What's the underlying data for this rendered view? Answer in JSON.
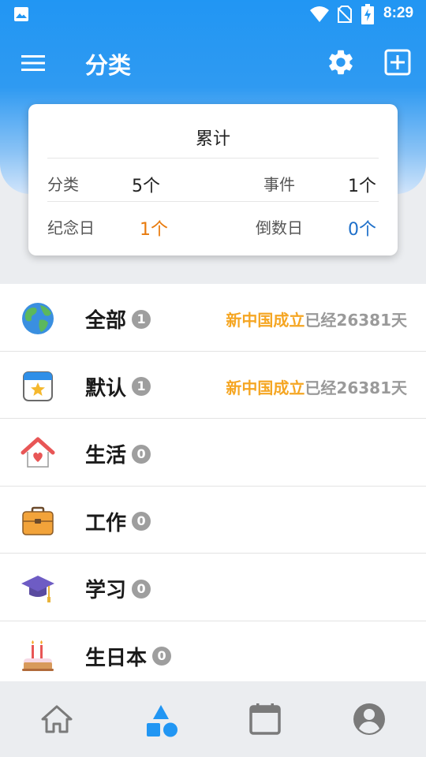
{
  "status_bar": {
    "time": "8:29"
  },
  "toolbar": {
    "title": "分类",
    "icons": [
      "menu-icon",
      "settings-icon",
      "add-box-icon"
    ]
  },
  "summary": {
    "title": "累计",
    "stats": [
      {
        "label": "分类",
        "value": "5个"
      },
      {
        "label": "事件",
        "value": "1个"
      },
      {
        "label": "纪念日",
        "value": "1个"
      },
      {
        "label": "倒数日",
        "value": "0个"
      }
    ],
    "colors": {
      "anniversary": "#E87A0C",
      "countdown": "#1E6FC9"
    }
  },
  "categories": [
    {
      "name": "全部",
      "count": "1",
      "icon": "globe-icon",
      "event_name": "新中国成立",
      "event_text": "已经26381天"
    },
    {
      "name": "默认",
      "count": "1",
      "icon": "calendar-star-icon",
      "event_name": "新中国成立",
      "event_text": "已经26381天"
    },
    {
      "name": "生活",
      "count": "0",
      "icon": "house-heart-icon"
    },
    {
      "name": "工作",
      "count": "0",
      "icon": "briefcase-icon"
    },
    {
      "name": "学习",
      "count": "0",
      "icon": "graduation-cap-icon"
    },
    {
      "name": "生日本",
      "count": "0",
      "icon": "birthday-cake-icon"
    }
  ],
  "bottom_nav": {
    "items": [
      "home-icon",
      "categories-icon",
      "calendar-icon",
      "profile-icon"
    ],
    "active_index": 1,
    "active_color": "#2196F3",
    "inactive_color": "#7A7A7A"
  }
}
